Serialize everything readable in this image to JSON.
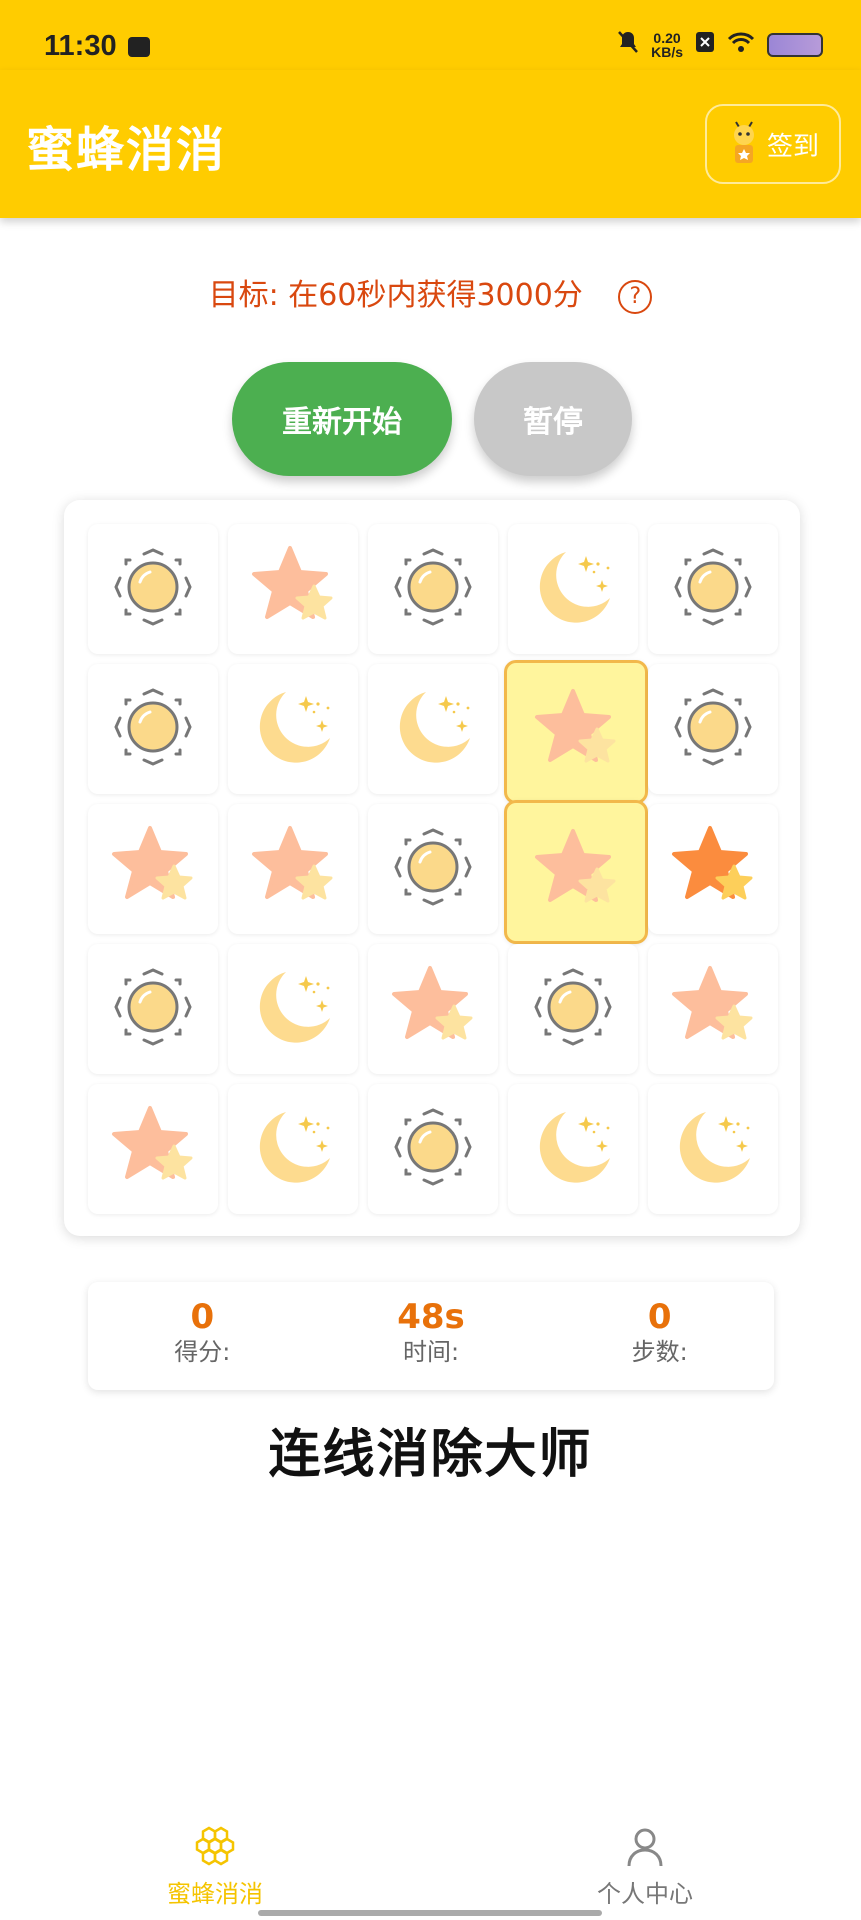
{
  "status_bar": {
    "time": "11:30",
    "net_speed_value": "0.20",
    "net_speed_unit": "KB/s"
  },
  "app_bar": {
    "title": "蜜蜂消消",
    "checkin_label": "签到"
  },
  "goal": {
    "text": "目标: 在60秒内获得3000分",
    "help_symbol": "?"
  },
  "controls": {
    "restart_label": "重新开始",
    "pause_label": "暂停"
  },
  "board": {
    "rows": [
      [
        "sun",
        "star",
        "sun",
        "moon",
        "sun"
      ],
      [
        "sun",
        "moon",
        "moon",
        "star",
        "sun"
      ],
      [
        "star",
        "star",
        "sun",
        "star",
        "star-dark"
      ],
      [
        "sun",
        "moon",
        "star",
        "sun",
        "star"
      ],
      [
        "star",
        "moon",
        "sun",
        "moon",
        "moon"
      ]
    ],
    "selected": [
      [
        1,
        3
      ],
      [
        2,
        3
      ]
    ]
  },
  "stats": {
    "score_value": "0",
    "score_label": "得分:",
    "time_value": "48s",
    "time_label": "时间:",
    "steps_value": "0",
    "steps_label": "步数:"
  },
  "game_name": "连线消除大师",
  "tabs": {
    "game_label": "蜜蜂消消",
    "profile_label": "个人中心"
  },
  "colors": {
    "brand_yellow": "#FFCC00",
    "restart_green": "#4CAF50",
    "pause_gray": "#C8C8C8",
    "goal_text": "#D9480F",
    "stat_value": "#E8710A",
    "selected_cell": "#FFF59D"
  }
}
